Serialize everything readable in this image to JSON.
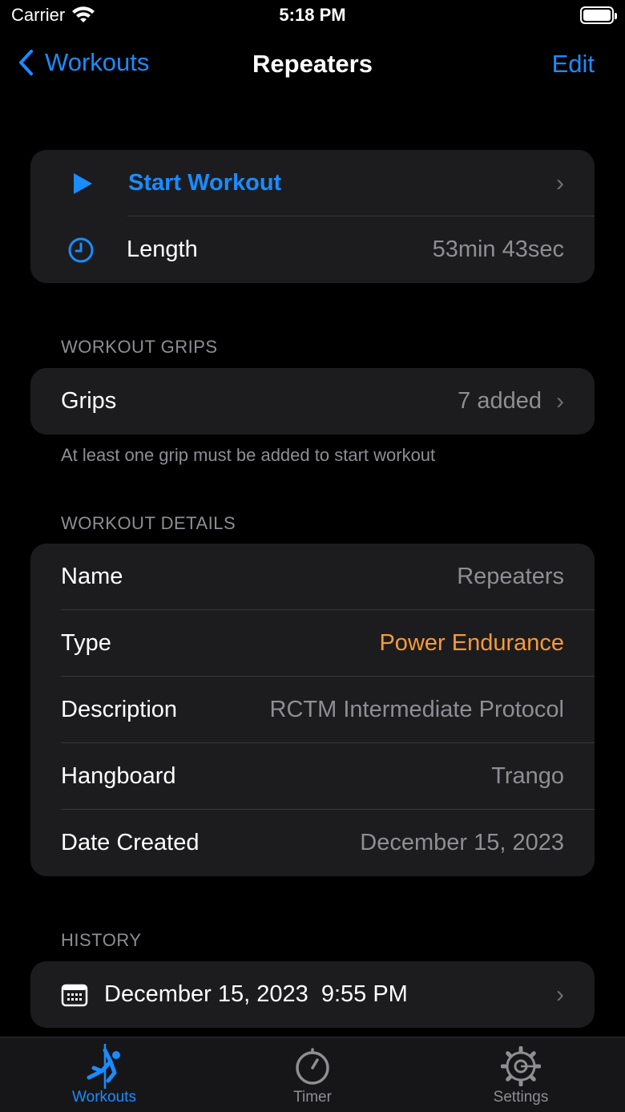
{
  "status": {
    "carrier": "Carrier",
    "time": "5:18 PM"
  },
  "nav": {
    "back_label": "Workouts",
    "title": "Repeaters",
    "edit_label": "Edit"
  },
  "start_card": {
    "start_label": "Start Workout",
    "length_label": "Length",
    "length_value": "53min 43sec"
  },
  "grips_section": {
    "header": "WORKOUT GRIPS",
    "label": "Grips",
    "value": "7 added",
    "footer": "At least one grip must be added to start workout"
  },
  "details_section": {
    "header": "WORKOUT DETAILS",
    "rows": [
      {
        "label": "Name",
        "value": "Repeaters"
      },
      {
        "label": "Type",
        "value": "Power Endurance"
      },
      {
        "label": "Description",
        "value": "RCTM Intermediate Protocol"
      },
      {
        "label": "Hangboard",
        "value": "Trango"
      },
      {
        "label": "Date Created",
        "value": "December 15, 2023"
      }
    ]
  },
  "history_section": {
    "header": "HISTORY",
    "entry": "December 15, 2023  9:55 PM"
  },
  "tabs": [
    {
      "label": "Workouts",
      "icon": "climber-icon"
    },
    {
      "label": "Timer",
      "icon": "timer-icon"
    },
    {
      "label": "Settings",
      "icon": "gear-icon"
    }
  ],
  "colors": {
    "accent": "#1a8cff",
    "type_highlight": "#f59a3a",
    "background": "#000000",
    "card": "#1c1c1e"
  }
}
